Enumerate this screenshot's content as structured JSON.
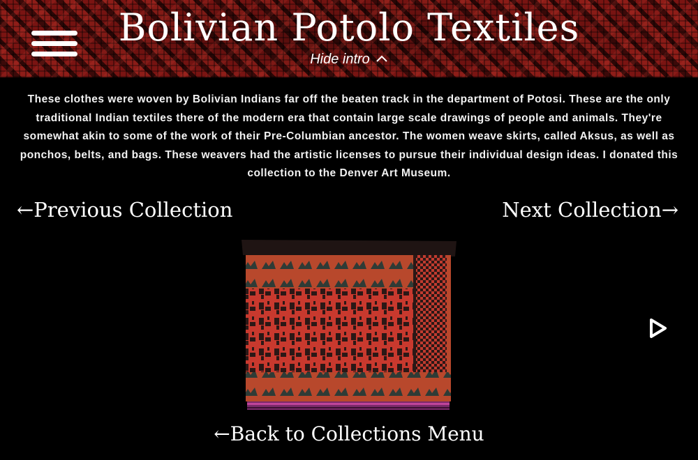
{
  "header": {
    "title": "Bolivian Potolo Textiles",
    "hide_intro_label": "Hide intro",
    "hide_intro_icon": "chevron-up-icon",
    "menu_icon": "hamburger-menu-icon"
  },
  "intro": {
    "text": "These clothes were woven by Bolivian Indians far off the beaten track in the department of Potosi. These are the only traditional Indian textiles there of the modern era that contain large scale drawings of people and animals. They're somewhat akin to some of the work of their Pre-Columbian ancestor. The women weave skirts, called Aksus, as well as ponchos, belts, and bags. These weavers had the artistic licenses to pursue their individual design ideas. I donated this collection to the Denver Art Museum."
  },
  "navigation": {
    "previous_label": "←Previous Collection",
    "next_label": "Next Collection→",
    "back_label": "←Back to Collections Menu"
  },
  "slideshow": {
    "play_icon": "play-icon"
  },
  "colors": {
    "background": "#000000",
    "banner_red": "#6e1411",
    "textile_red": "#d9473a",
    "textile_dark": "#2a1a18",
    "text": "#ffffff"
  }
}
